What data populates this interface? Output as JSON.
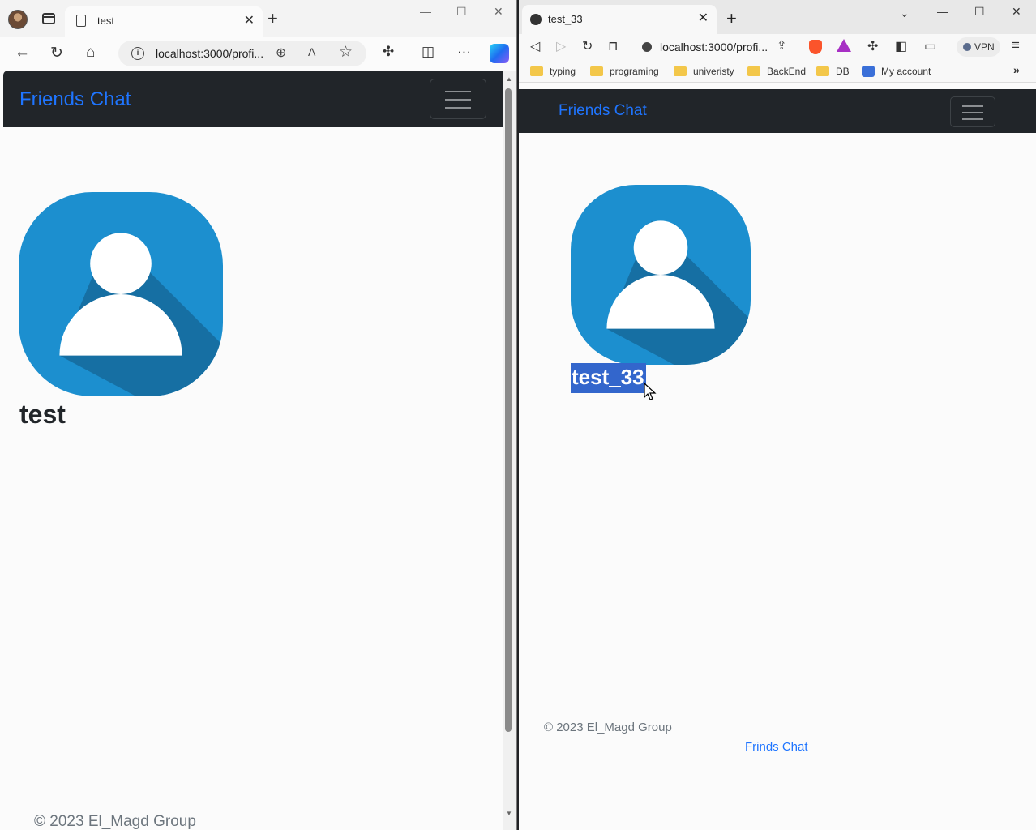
{
  "left_browser": {
    "tab_title": "test",
    "url": "localhost:3000/profi...",
    "navbar": {
      "brand": "Friends Chat"
    },
    "profile": {
      "username": "test"
    },
    "footer": {
      "copyright": "© 2023 El_Magd Group"
    }
  },
  "right_browser": {
    "tab_title": "test_33",
    "url": "localhost:3000/profi...",
    "vpn_label": "VPN",
    "bookmarks": [
      "typing",
      "programing",
      "univeristy",
      "BackEnd",
      "DB",
      "My account"
    ],
    "navbar": {
      "brand": "Friends Chat"
    },
    "profile": {
      "username": "test_33",
      "username_selected": true
    },
    "footer": {
      "copyright": "© 2023 El_Magd Group",
      "link": "Frinds Chat"
    }
  },
  "colors": {
    "navbar_bg": "#212529",
    "brand": "#1f75ff",
    "avatar_bg": "#1c8fcf",
    "avatar_shadow": "#166fa3",
    "selection": "#3366cc"
  },
  "icons": {
    "left": [
      "profile-avatar",
      "back-icon",
      "reload-icon",
      "home-icon",
      "info-icon",
      "zoom-icon",
      "read-aloud-icon",
      "favorite-star-icon",
      "extensions-icon",
      "split-screen-icon",
      "more-icon",
      "copilot-icon"
    ],
    "right": [
      "globe-icon",
      "back-icon",
      "forward-icon",
      "reload-icon",
      "bookmark-icon",
      "share-icon",
      "brave-shields-icon",
      "brave-rewards-icon",
      "extensions-icon",
      "sidebar-icon",
      "wallet-icon",
      "menu-icon"
    ]
  }
}
